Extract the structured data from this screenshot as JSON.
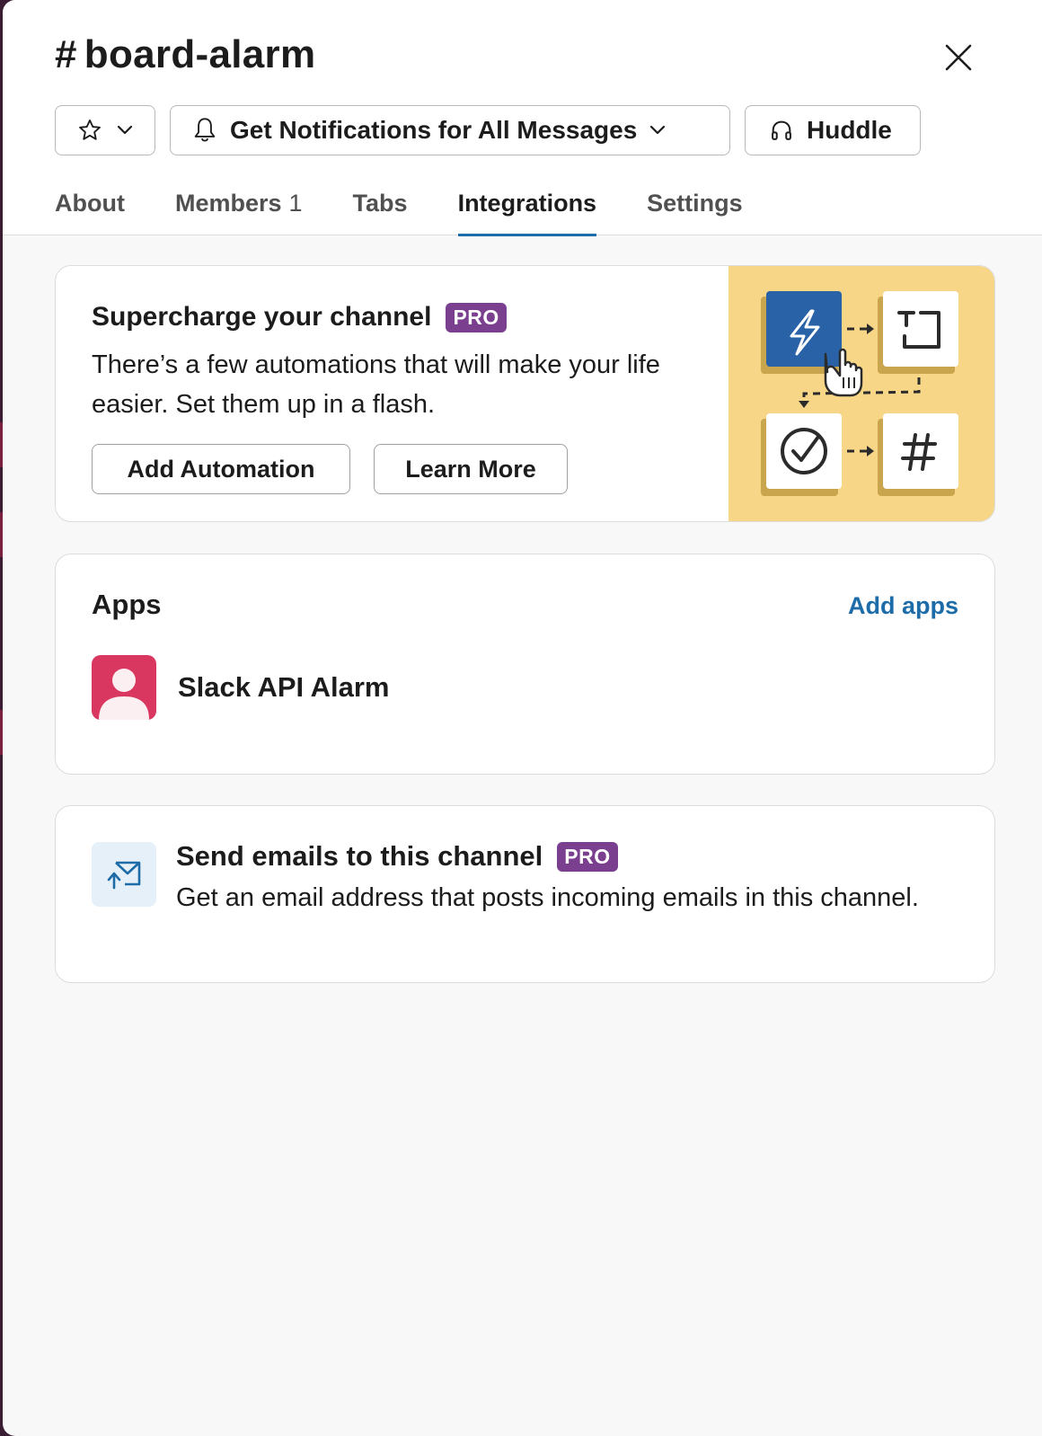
{
  "channel": {
    "hash": "#",
    "name": "board-alarm"
  },
  "header": {
    "notifications_label": "Get Notifications for All Messages",
    "huddle_label": "Huddle"
  },
  "tabs": [
    {
      "label": "About"
    },
    {
      "label": "Members",
      "count": "1"
    },
    {
      "label": "Tabs"
    },
    {
      "label": "Integrations",
      "active": true
    },
    {
      "label": "Settings"
    }
  ],
  "promo": {
    "title": "Supercharge your channel",
    "badge": "PRO",
    "description": "There’s a few automations that will make your life easier. Set them up in a flash.",
    "add_automation_label": "Add Automation",
    "learn_more_label": "Learn More"
  },
  "apps": {
    "title": "Apps",
    "add_label": "Add apps",
    "items": [
      {
        "name": "Slack API Alarm",
        "avatar_color": "#d9375f"
      }
    ]
  },
  "email": {
    "title": "Send emails to this channel",
    "badge": "PRO",
    "description": "Get an email address that posts incoming emails in this channel."
  },
  "colors": {
    "accent": "#1d6ca8",
    "pro_badge": "#7b3f8f",
    "illustration_bg": "#f7d688"
  }
}
